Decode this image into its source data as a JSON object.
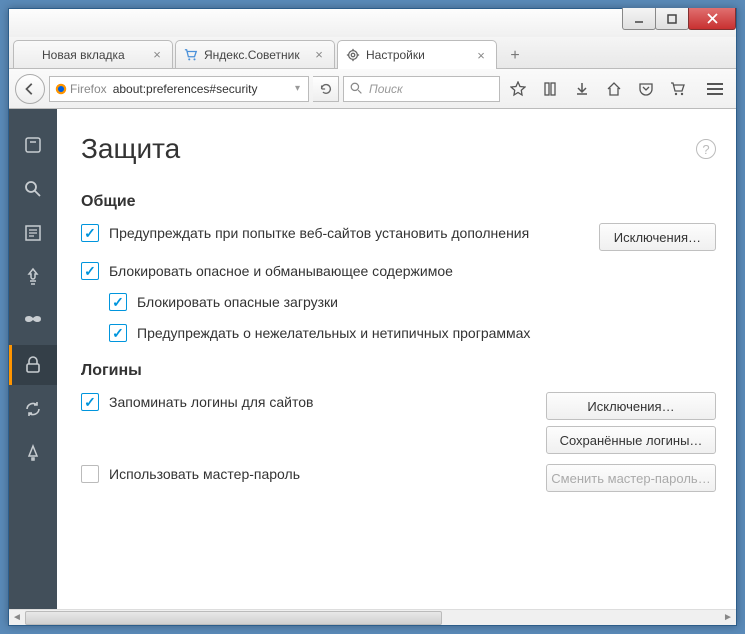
{
  "window": {
    "tabs": [
      {
        "label": "Новая вкладка",
        "active": false
      },
      {
        "label": "Яндекс.Советник",
        "active": false
      },
      {
        "label": "Настройки",
        "active": true
      }
    ]
  },
  "navbar": {
    "identity_label": "Firefox",
    "url": "about:preferences#security",
    "search_placeholder": "Поиск"
  },
  "page": {
    "title": "Защита",
    "sections": {
      "general": {
        "heading": "Общие",
        "warn_addons": "Предупреждать при попытке веб-сайтов установить дополнения",
        "exceptions_btn": "Исключения…",
        "block_dangerous": "Блокировать опасное и обманывающее содержимое",
        "block_downloads": "Блокировать опасные загрузки",
        "warn_unwanted": "Предупреждать о нежелательных и нетипичных программах"
      },
      "logins": {
        "heading": "Логины",
        "remember": "Запоминать логины для сайтов",
        "exceptions_btn": "Исключения…",
        "saved_btn": "Сохранённые логины…",
        "master_pw": "Использовать мастер-пароль",
        "change_master_btn": "Сменить мастер-пароль…"
      }
    }
  }
}
